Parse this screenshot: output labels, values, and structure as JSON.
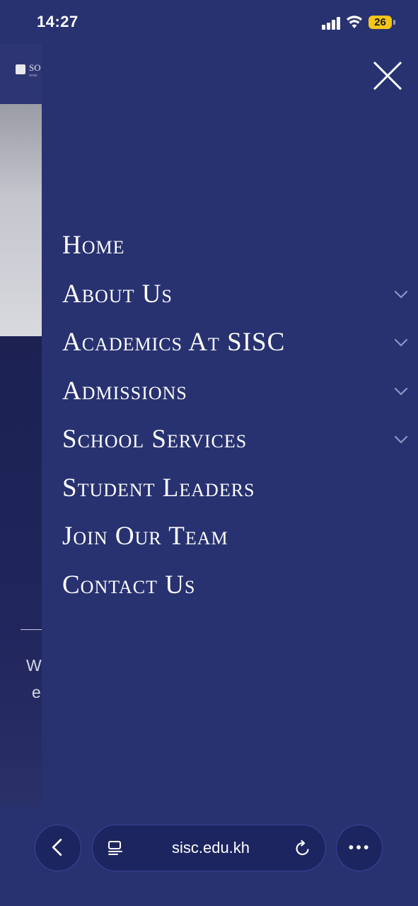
{
  "status_bar": {
    "time": "14:27",
    "battery_level": "26",
    "icons": [
      "signal-icon",
      "wifi-icon",
      "battery-icon"
    ]
  },
  "background_page": {
    "logo_text": "SO",
    "logo_subtext": "INTER",
    "partial_text_1": "W",
    "partial_text_2": "e"
  },
  "menu": {
    "close_icon": "close-icon",
    "items": [
      {
        "label": "Home",
        "has_submenu": false
      },
      {
        "label": "About Us",
        "has_submenu": true
      },
      {
        "label": "Academics At SISC",
        "has_submenu": true
      },
      {
        "label": "Admissions",
        "has_submenu": true
      },
      {
        "label": "School Services",
        "has_submenu": true
      },
      {
        "label": "Student Leaders",
        "has_submenu": false
      },
      {
        "label": "Join Our Team",
        "has_submenu": false
      },
      {
        "label": "Contact Us",
        "has_submenu": false
      }
    ]
  },
  "browser": {
    "url": "sisc.edu.kh",
    "back_icon": "back-chevron-icon",
    "reader_icon": "reader-mode-icon",
    "reload_icon": "reload-icon",
    "more_icon": "more-dots-icon"
  },
  "colors": {
    "panel_background": "#283270",
    "menu_text": "#ffffff",
    "chevron": "#8e95c4",
    "battery": "#f5c518"
  }
}
